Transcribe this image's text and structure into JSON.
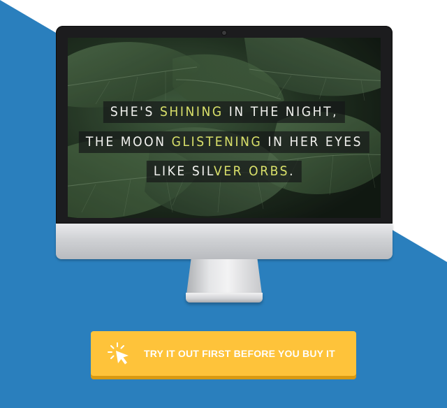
{
  "screen_quote": {
    "line1": {
      "a": "SHE'S ",
      "b": "SHINING",
      "c": " IN THE NIGHT,"
    },
    "line2": {
      "a": "THE MOON ",
      "b": "GLISTENING",
      "c": " IN HER EYES"
    },
    "line3": {
      "a": "LIKE SIL",
      "b": "VER ORBS",
      "c": "."
    }
  },
  "cta": {
    "label": "TRY IT OUT FIRST BEFORE YOU BUY IT",
    "icon": "cursor-click-icon"
  },
  "colors": {
    "background_blue": "#2a7fbd",
    "background_white": "#ffffff",
    "accent_yellow": "#fec33a",
    "highlight_text": "#d9e06a"
  }
}
